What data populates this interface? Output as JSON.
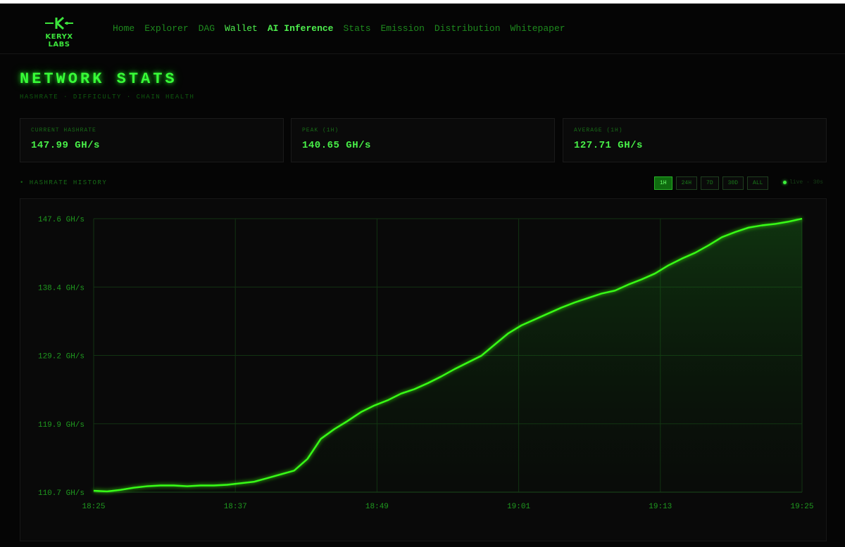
{
  "brand": {
    "name": "KERYX LABS",
    "logo_icon": "keryx-k-logo-icon",
    "accent": "#38ff38"
  },
  "nav": [
    {
      "label": "Home",
      "style": "dim"
    },
    {
      "label": "Explorer",
      "style": "dim"
    },
    {
      "label": "DAG",
      "style": "dim"
    },
    {
      "label": "Wallet",
      "style": "bright"
    },
    {
      "label": "AI Inference",
      "style": "bold"
    },
    {
      "label": "Stats",
      "style": "dim"
    },
    {
      "label": "Emission",
      "style": "dim"
    },
    {
      "label": "Distribution",
      "style": "dim"
    },
    {
      "label": "Whitepaper",
      "style": "dim"
    }
  ],
  "page": {
    "title": "NETWORK STATS",
    "subtitle": "HASHRATE · DIFFICULTY · CHAIN HEALTH"
  },
  "cards": [
    {
      "label": "CURRENT HASHRATE",
      "value": "147.99 GH/s"
    },
    {
      "label": "PEAK (1H)",
      "value": "140.65 GH/s"
    },
    {
      "label": "AVERAGE (1H)",
      "value": "127.71 GH/s"
    }
  ],
  "history": {
    "label": "• HASHRATE HISTORY",
    "ranges": [
      "1H",
      "24H",
      "7D",
      "30D",
      "ALL"
    ],
    "active_range": "1H",
    "live_text": "live · 30s"
  },
  "chart_data": {
    "type": "area",
    "title": "",
    "xlabel": "",
    "ylabel": "",
    "unit": "GH/s",
    "ylim": [
      110.7,
      147.6
    ],
    "yticks": [
      "147.6 GH/s",
      "138.4 GH/s",
      "129.2 GH/s",
      "119.9 GH/s",
      "110.7 GH/s"
    ],
    "xticks": [
      "18:25",
      "18:37",
      "18:49",
      "19:01",
      "19:13",
      "19:25"
    ],
    "xlim_minutes": [
      0,
      60
    ],
    "grid": true,
    "line_color": "#39ff14",
    "x": [
      0,
      1,
      2,
      3,
      4,
      5,
      6,
      7,
      8,
      9,
      10,
      11,
      12,
      13,
      14,
      15,
      16,
      17,
      18,
      19,
      20,
      21,
      22,
      23,
      24,
      25,
      26,
      27,
      28,
      29,
      30,
      31,
      32,
      33,
      34,
      35,
      36,
      37,
      38,
      39,
      40,
      41,
      42,
      43,
      44,
      45,
      46,
      47,
      48,
      49,
      50,
      51,
      52,
      53,
      54,
      55,
      56,
      57,
      58,
      59,
      60
    ],
    "values": [
      110.9,
      110.8,
      111.0,
      111.3,
      111.5,
      111.6,
      111.6,
      111.5,
      111.6,
      111.6,
      111.7,
      111.9,
      112.1,
      112.6,
      113.1,
      113.6,
      115.2,
      117.9,
      119.2,
      120.3,
      121.5,
      122.4,
      123.1,
      124.0,
      124.6,
      125.4,
      126.3,
      127.3,
      128.2,
      129.1,
      130.6,
      132.1,
      133.2,
      134.0,
      134.8,
      135.6,
      136.3,
      136.9,
      137.5,
      137.9,
      138.7,
      139.4,
      140.2,
      141.3,
      142.2,
      143.0,
      144.0,
      145.1,
      145.8,
      146.4,
      146.7,
      146.9,
      147.2,
      147.6
    ],
    "series": [
      {
        "values_ref": "values"
      }
    ]
  }
}
